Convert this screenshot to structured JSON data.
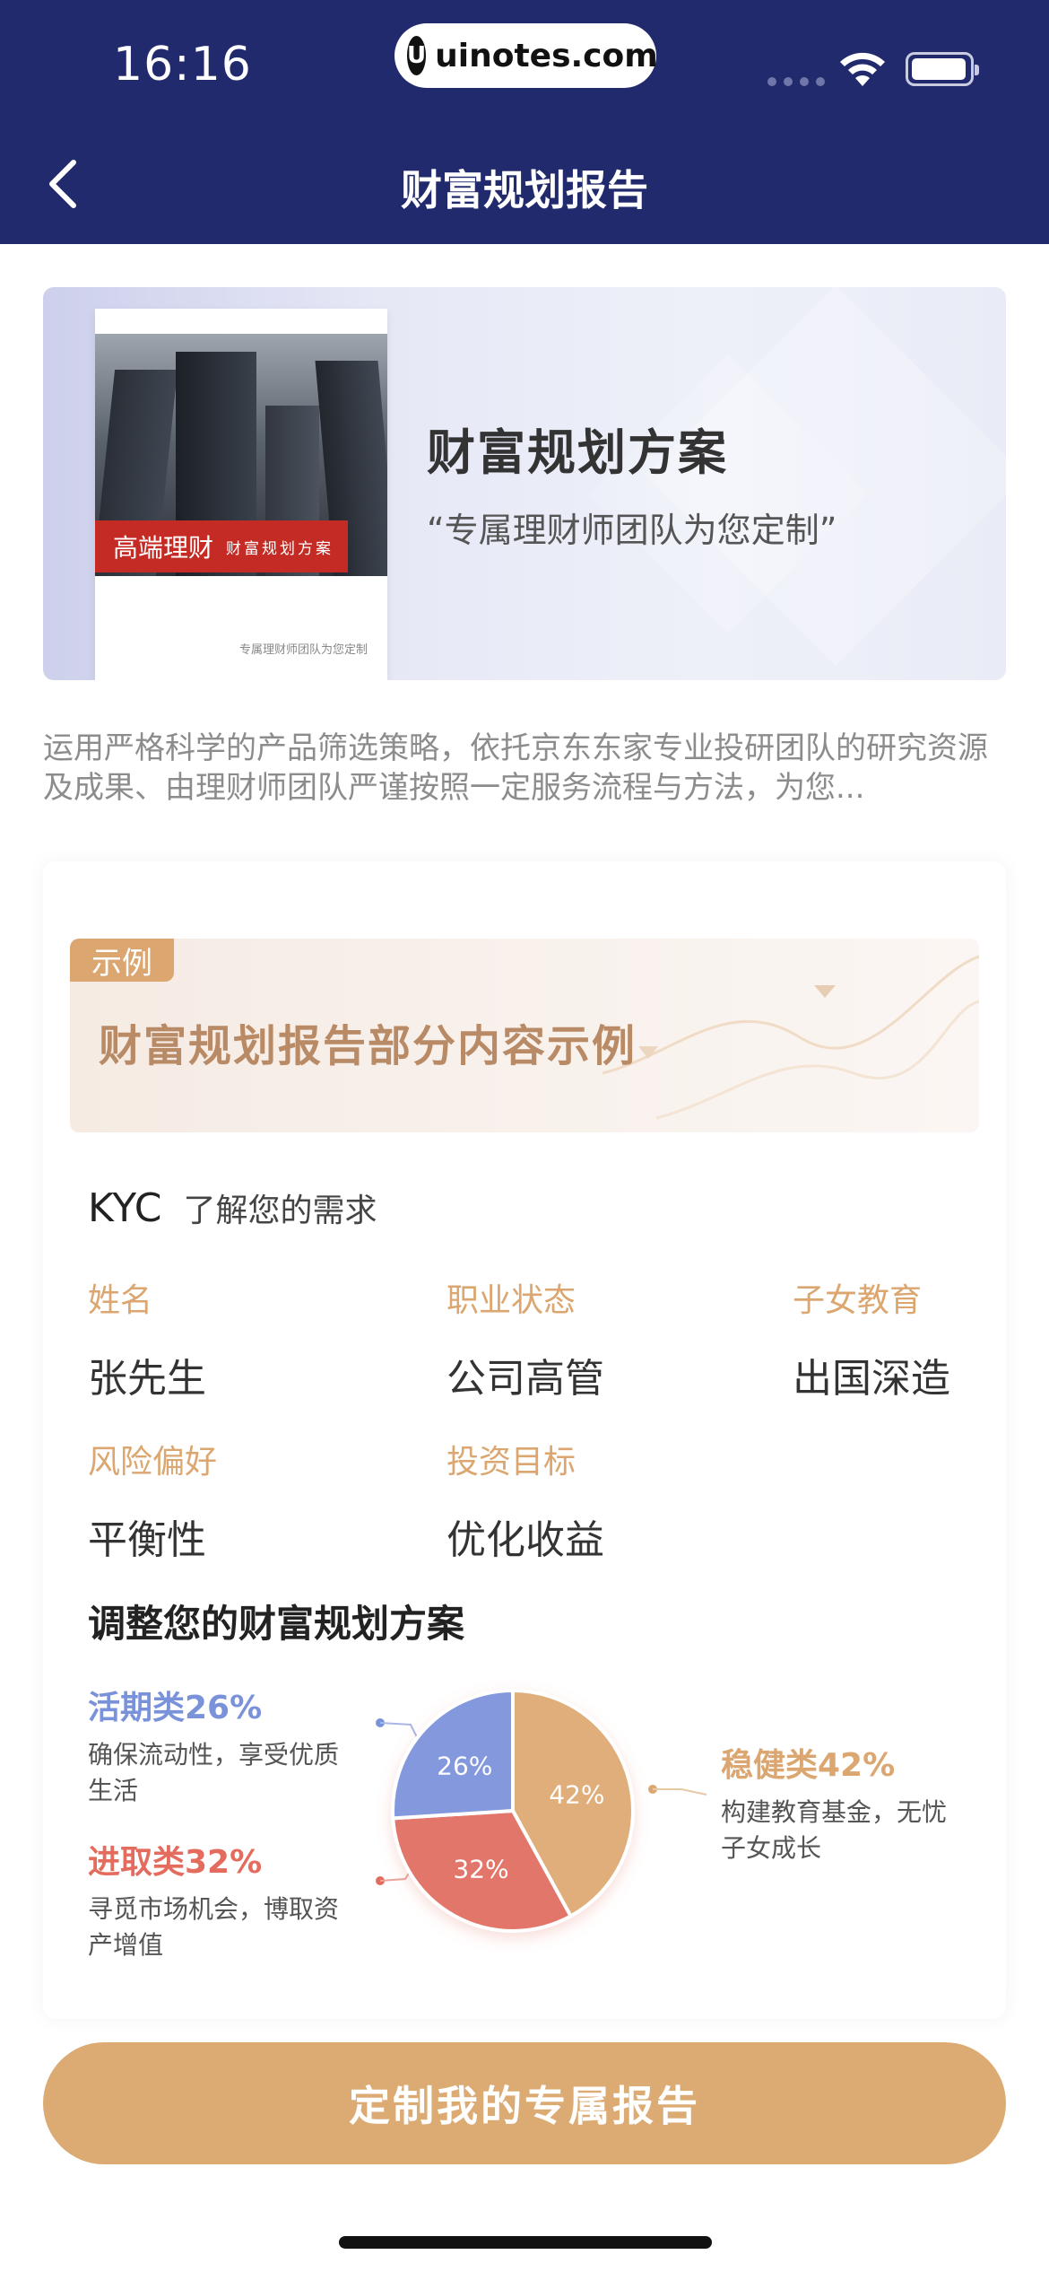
{
  "status_bar": {
    "time": "16:16",
    "url": "uinotes.com"
  },
  "header": {
    "title": "财富规划报告"
  },
  "hero": {
    "title": "财富规划方案",
    "subtitle": "“专属理财师团队为您定制”",
    "book_band_main": "高端理财",
    "book_band_sub": "财富规划方案",
    "book_footer": "专属理财师团队为您定制"
  },
  "description": "运用严格科学的产品筛选策略，依托京东东家专业投研团队的研究资源及成果、由理财师团队严谨按照一定服务流程与方法，为您...",
  "sample": {
    "tag": "示例",
    "title": "财富规划报告部分内容示例"
  },
  "kyc": {
    "label": "KYC",
    "subtitle": "了解您的需求",
    "fields": [
      {
        "label": "姓名",
        "value": "张先生"
      },
      {
        "label": "职业状态",
        "value": "公司高管"
      },
      {
        "label": "子女教育",
        "value": "出国深造"
      },
      {
        "label": "风险偏好",
        "value": "平衡性"
      },
      {
        "label": "投资目标",
        "value": "优化收益"
      }
    ]
  },
  "adjust_title": "调整您的财富规划方案",
  "chart_data": {
    "type": "pie",
    "series": [
      {
        "name": "稳健类",
        "value": 42,
        "label": "42%",
        "color": "#dfae7a"
      },
      {
        "name": "进取类",
        "value": 32,
        "label": "32%",
        "color": "#e3766a"
      },
      {
        "name": "活期类",
        "value": 26,
        "label": "26%",
        "color": "#8499dd"
      }
    ]
  },
  "legends": {
    "liquid": {
      "title": "活期类26%",
      "desc": "确保流动性，享受优质生活",
      "color": "#7a92d9"
    },
    "aggressive": {
      "title": "进取类32%",
      "desc": "寻觅市场机会，博取资产增值",
      "color": "#e36c5e"
    },
    "stable": {
      "title": "稳健类42%",
      "desc": "构建教育基金，无忧子女成长",
      "color": "#dba66f"
    }
  },
  "cta": {
    "label": "定制我的专属报告"
  }
}
